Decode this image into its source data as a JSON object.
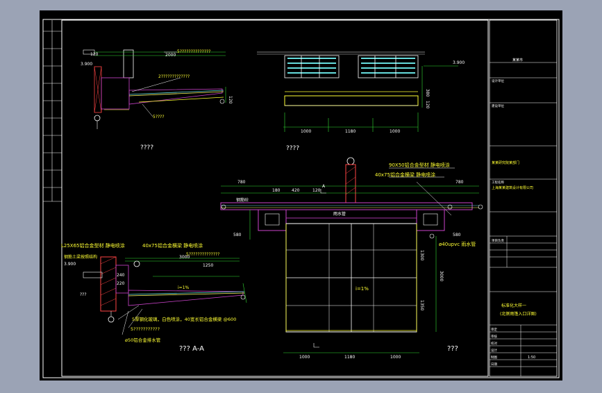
{
  "colors": {
    "window_bg": "#9ba3b5",
    "sheet_bg": "#000000",
    "frame": "#ffffff",
    "dimension": "#33dd33",
    "annotation": "#ffff33",
    "wall": "#ff4444",
    "hatch": "#cc44cc",
    "glass": "#66dddd",
    "metal": "#ffff66"
  },
  "views": {
    "top_left_label": "????",
    "top_right_label": "????",
    "section_label": "??? A-A",
    "plan_label": "???"
  },
  "top_left": {
    "dim_120": "120",
    "dim_2000": "2000",
    "level": "3.900",
    "note_top": "5??????????????",
    "note_mid": "2?????????????",
    "note_bot": "5????",
    "dim_side": "120"
  },
  "top_right": {
    "level": "3.900",
    "dims": [
      "1000",
      "1180",
      "1000"
    ],
    "side_dims": [
      "380",
      "120"
    ]
  },
  "section": {
    "note_1": "L25X65铝合金型材 静电喷涂",
    "note_2": "40x75铝合金横梁 静电喷涂",
    "note_3": "钢筋土梁按照结构",
    "note_4": "5??????????????",
    "note_5": "5厚钢化玻璃，白色喷涂，40宽长铝合金横梁 @600",
    "note_6": "5???????????",
    "note_7": "ø50铝合金排水管",
    "level": "3.900",
    "dim_3000": "3000",
    "dim_1250": "1250",
    "dim_240": "240",
    "dim_220": "220",
    "slope": "i=1%",
    "code": "???"
  },
  "plan": {
    "note_1": "90X50铝合金型材 静电喷涂",
    "note_2": "40x75铝合金横梁 静电喷涂",
    "note_3": "ø40upvc 雨水管",
    "label_a": "A",
    "label_beam": "雨水管",
    "label_slot": "钢筋砼",
    "slope": "i=1%",
    "top_dims": [
      "780",
      "180",
      "420",
      "120",
      "780"
    ],
    "bottom_dims": [
      "1000",
      "1180",
      "1000"
    ],
    "left_dims": [
      "580",
      "580"
    ],
    "right_dims": [
      "1300",
      "3000",
      "1350"
    ]
  },
  "title_block": {
    "project": "某某市",
    "designer_line": "上海某某建筑设计有限公司",
    "owner": "某某研究院某部门",
    "sheet_title_1": "标准化大样一",
    "sheet_title_2": "(北侧雨篷入口详图)",
    "scale": "1:50",
    "rows": [
      "设计单位",
      "建设单位",
      "工程名称",
      "项目负责",
      "审定",
      "审核",
      "校对",
      "设计",
      "制图",
      "日期"
    ]
  }
}
